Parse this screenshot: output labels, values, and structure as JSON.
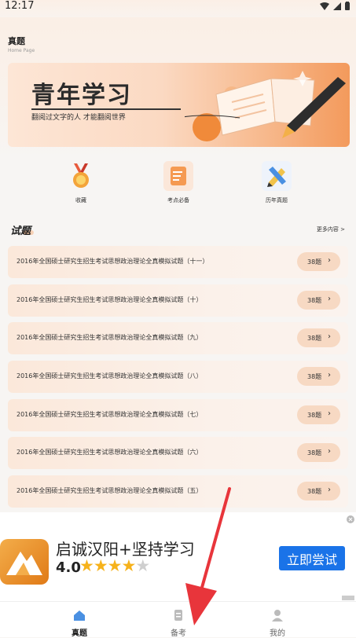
{
  "status_bar": {
    "time": "12:17"
  },
  "header": {
    "title": "真题",
    "subtitle": "Home Page"
  },
  "banner": {
    "title": "青年学习",
    "slogan": "翻阅过文字的人 才能翻阅世界"
  },
  "quick_links": [
    {
      "label": "收藏",
      "icon": "medal-icon"
    },
    {
      "label": "考点必备",
      "icon": "notes-icon"
    },
    {
      "label": "历年真题",
      "icon": "pencil-ruler-icon"
    }
  ],
  "section": {
    "title": "试题",
    "more": "更多内容 >"
  },
  "questions": [
    {
      "title": "2016年全国硕士研究生招生考试思想政治理论全真模拟试题（十一）",
      "count": "38题"
    },
    {
      "title": "2016年全国硕士研究生招生考试思想政治理论全真模拟试题（十）",
      "count": "38题"
    },
    {
      "title": "2016年全国硕士研究生招生考试思想政治理论全真模拟试题（九）",
      "count": "38题"
    },
    {
      "title": "2016年全国硕士研究生招生考试思想政治理论全真模拟试题（八）",
      "count": "38题"
    },
    {
      "title": "2016年全国硕士研究生招生考试思想政治理论全真模拟试题（七）",
      "count": "38题"
    },
    {
      "title": "2016年全国硕士研究生招生考试思想政治理论全真模拟试题（六）",
      "count": "38题"
    },
    {
      "title": "2016年全国硕士研究生招生考试思想政治理论全真模拟试题（五）",
      "count": "38题"
    }
  ],
  "ad": {
    "title": "启诚汉阳+坚持学习",
    "rating": "4.0",
    "stars_filled": 4,
    "stars_total": 5,
    "cta": "立即尝试"
  },
  "nav": [
    {
      "label": "真题",
      "icon": "home-icon",
      "active": true
    },
    {
      "label": "备考",
      "icon": "document-icon",
      "active": false
    },
    {
      "label": "我的",
      "icon": "user-icon",
      "active": false
    }
  ],
  "colors": {
    "accent": "#f39a5c",
    "ad_button": "#1a73e8",
    "star": "#f6b21b"
  }
}
